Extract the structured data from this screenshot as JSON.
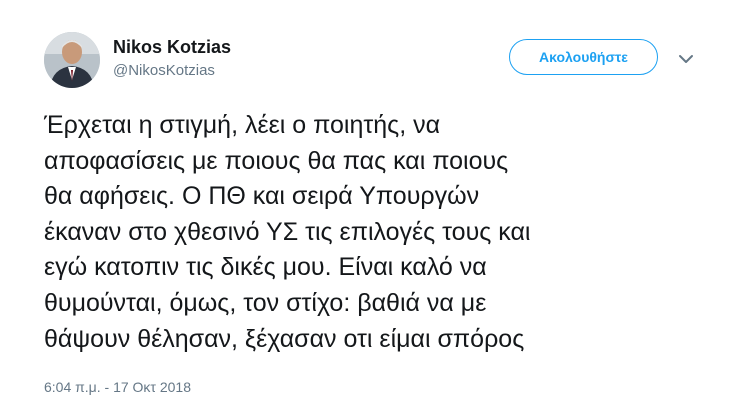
{
  "author": {
    "name": "Nikos Kotzias",
    "handle": "@NikosKotzias"
  },
  "follow_button": {
    "label": "Ακολουθήστε"
  },
  "icons": {
    "avatar": "profile-photo",
    "menu": "chevron-down-icon"
  },
  "tweet": {
    "text": "Έρχεται η στιγμή, λέει ο ποιητής, να\nαποφασίσεις με ποιους θα πας και ποιους\nθα αφήσεις. Ο ΠΘ και σειρά Υπουργών\nέκαναν στο χθεσινό ΥΣ τις επιλογές τους και\nεγώ κατοπιν τις δικές μου.  Είναι καλό να\nθυμούνται, όμως, τον στίχο: βαθιά να με\nθάψουν θέλησαν, ξέχασαν οτι είμαι σπόρος",
    "timestamp": "6:04 π.μ. - 17 Οκτ 2018"
  },
  "colors": {
    "accent": "#1da1f2",
    "text": "#14171a",
    "secondary_text": "#657786"
  }
}
